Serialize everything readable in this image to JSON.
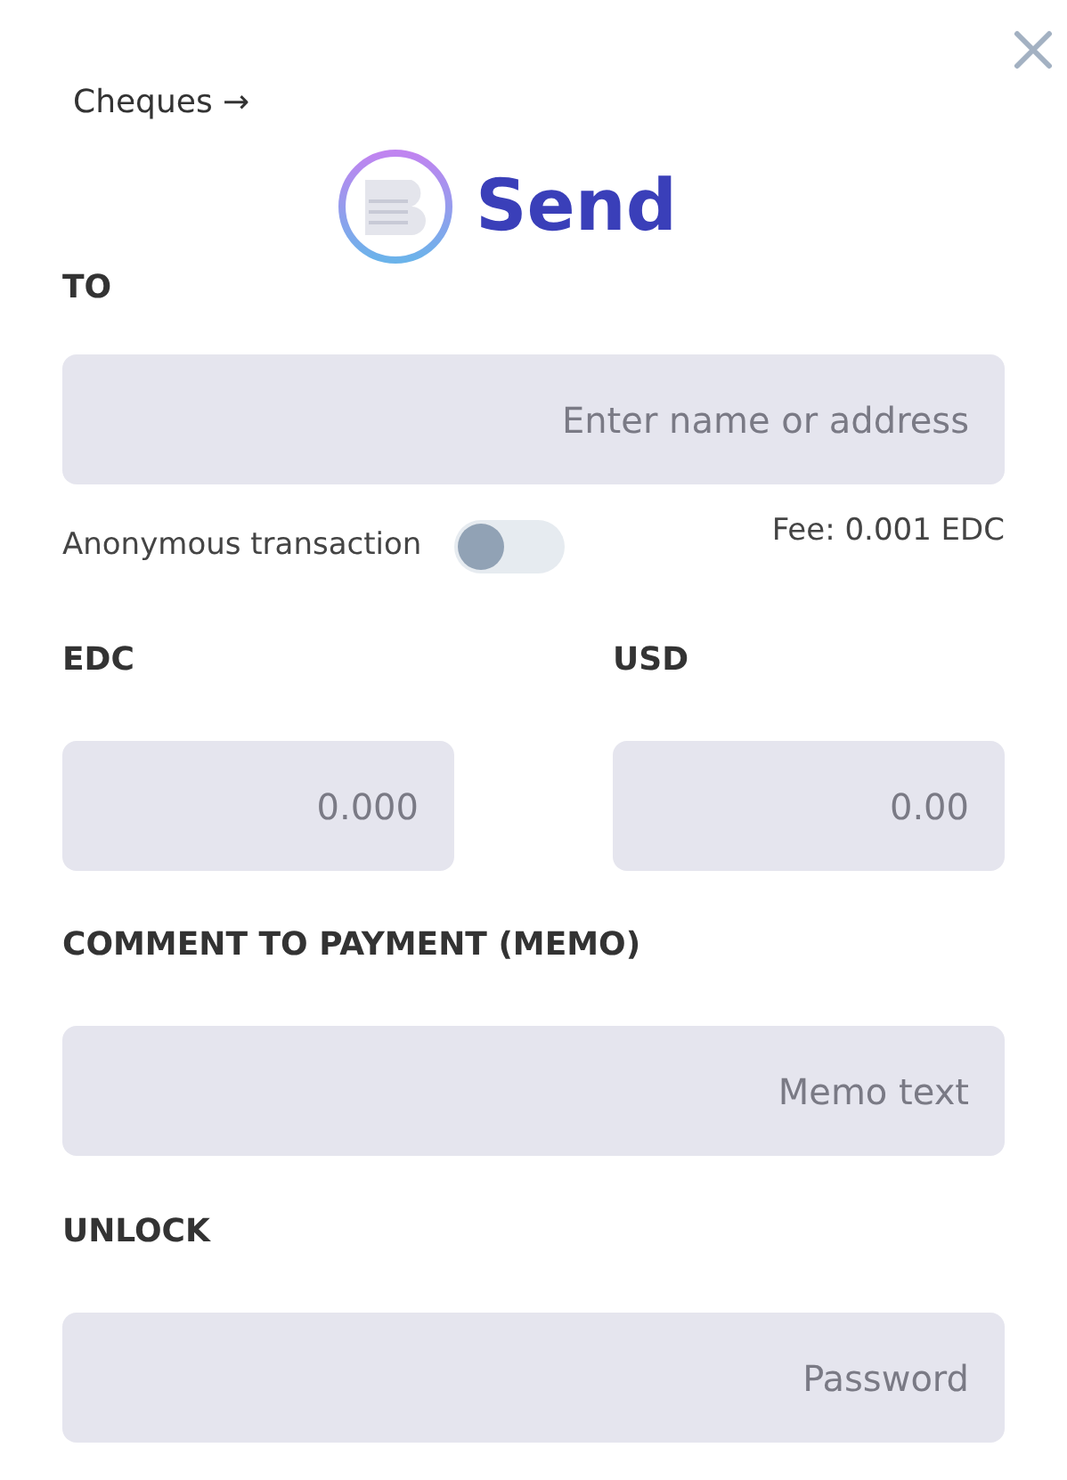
{
  "cheques_link": "Cheques →",
  "title": "Send",
  "to": {
    "label": "TO",
    "placeholder": "Enter name or address"
  },
  "anonymous": {
    "label": "Anonymous transaction",
    "on": false
  },
  "fee": "Fee: 0.001 EDC",
  "amounts": [
    {
      "label": "EDC",
      "placeholder": "0.000"
    },
    {
      "label": "USD",
      "placeholder": "0.00"
    }
  ],
  "memo": {
    "label": "COMMENT TO PAYMENT (MEMO)",
    "placeholder": "Memo text"
  },
  "unlock": {
    "label": "UNLOCK",
    "placeholder": "Password"
  }
}
